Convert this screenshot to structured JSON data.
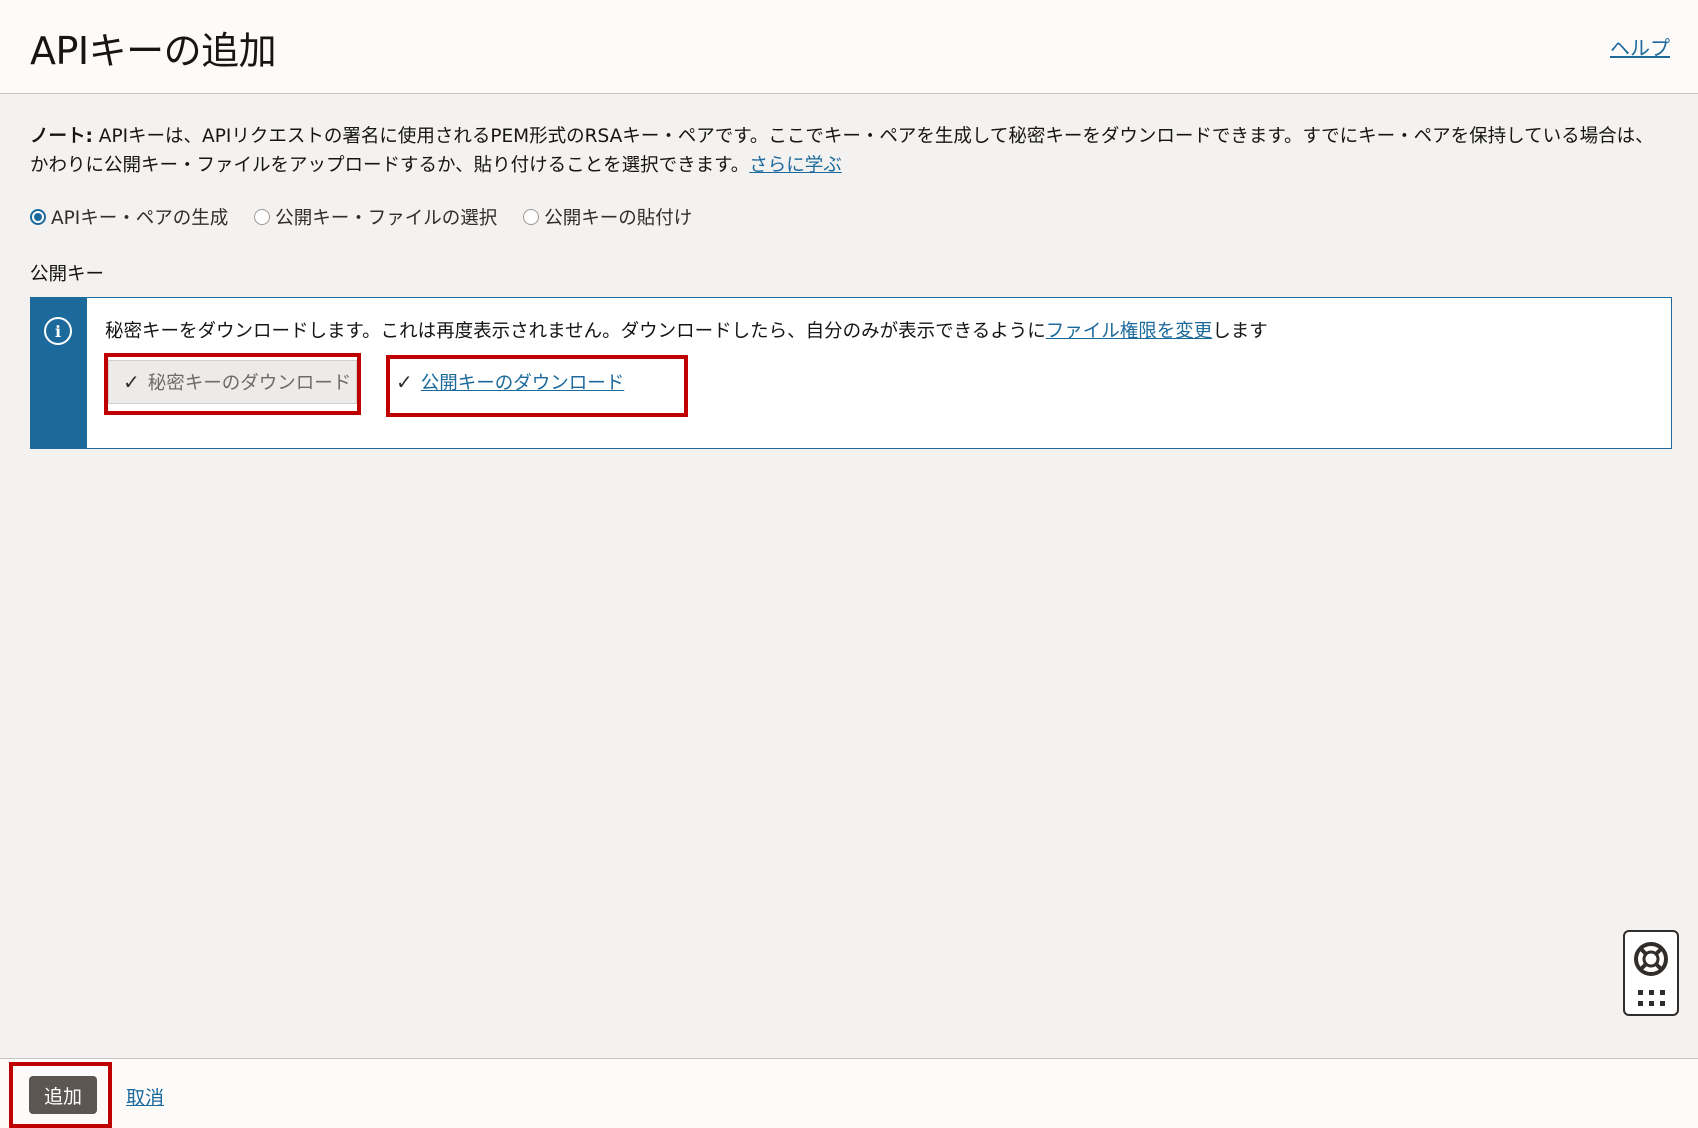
{
  "header": {
    "title": "APIキーの追加",
    "help_label": "ヘルプ"
  },
  "note": {
    "prefix": "ノート:",
    "text": " APIキーは、APIリクエストの署名に使用されるPEM形式のRSAキー・ペアです。ここでキー・ペアを生成して秘密キーをダウンロードできます。すでにキー・ペアを保持している場合は、かわりに公開キー・ファイルをアップロードするか、貼り付けることを選択できます。",
    "learn_more": "さらに学ぶ"
  },
  "options": [
    {
      "label": "APIキー・ペアの生成",
      "checked": true
    },
    {
      "label": "公開キー・ファイルの選択",
      "checked": false
    },
    {
      "label": "公開キーの貼付け",
      "checked": false
    }
  ],
  "public_key": {
    "section_label": "公開キー",
    "info_text_before": "秘密キーをダウンロードします。これは再度表示されません。ダウンロードしたら、自分のみが表示できるように",
    "info_link": "ファイル権限を変更",
    "info_text_after": "します",
    "download_private": "秘密キーのダウンロード",
    "download_public": "公開キーのダウンロード"
  },
  "footer": {
    "add_label": "追加",
    "cancel_label": "取消"
  },
  "colors": {
    "accent": "#1c6a9c",
    "highlight": "#c00000"
  }
}
